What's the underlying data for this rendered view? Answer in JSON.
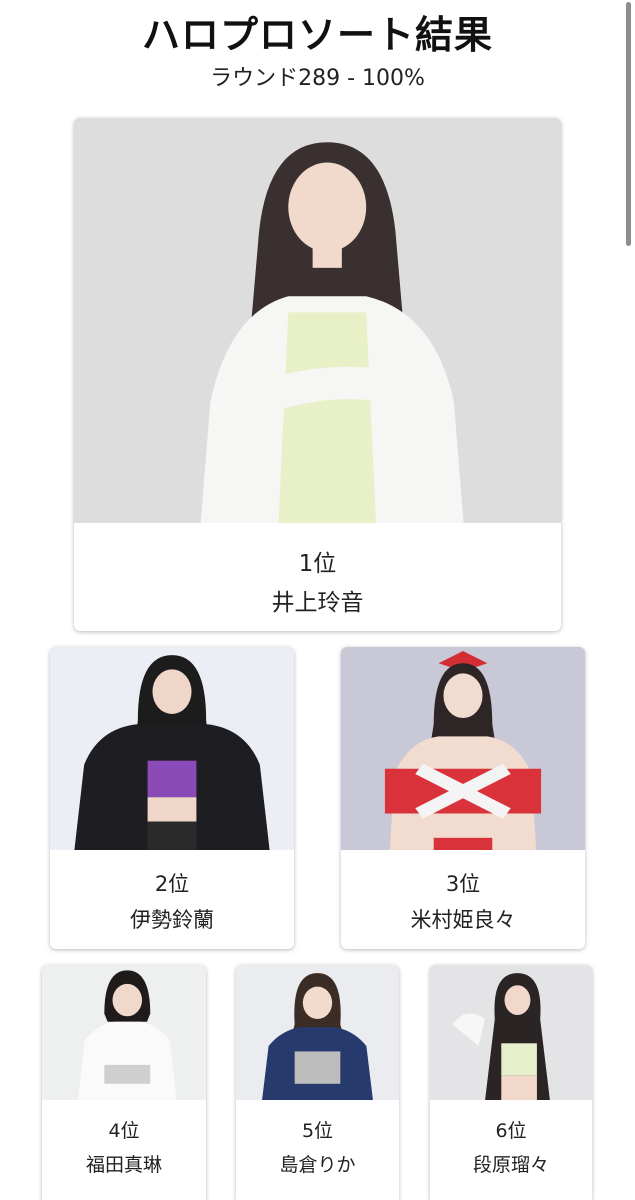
{
  "header": {
    "title": "ハロプロソート結果",
    "subtitle": "ラウンド289 - 100%"
  },
  "results": [
    {
      "rank": "1位",
      "name": "井上玲音"
    },
    {
      "rank": "2位",
      "name": "伊勢鈴蘭"
    },
    {
      "rank": "3位",
      "name": "米村姫良々"
    },
    {
      "rank": "4位",
      "name": "福田真琳"
    },
    {
      "rank": "5位",
      "name": "島倉りか"
    },
    {
      "rank": "6位",
      "name": "段原瑠々"
    }
  ]
}
